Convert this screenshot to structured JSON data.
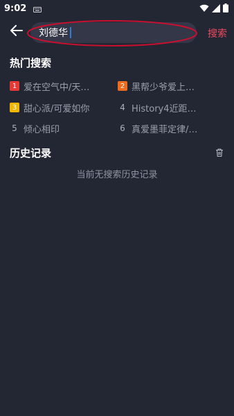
{
  "status_bar": {
    "time": "9:02"
  },
  "search": {
    "value": "刘德华",
    "action_label": "搜索"
  },
  "hot": {
    "title": "热门搜索",
    "items": [
      {
        "rank": "1",
        "text": "爱在空气中/天…",
        "color": "#e53935"
      },
      {
        "rank": "2",
        "text": "黑帮少爷爱上…",
        "color": "#ef6c1e"
      },
      {
        "rank": "3",
        "text": "甜心派/可爱如你",
        "color": "#f2b600"
      },
      {
        "rank": "4",
        "text": "History4近距…",
        "color": ""
      },
      {
        "rank": "5",
        "text": "倾心相印",
        "color": ""
      },
      {
        "rank": "6",
        "text": "真爱墨菲定律/…",
        "color": ""
      }
    ]
  },
  "history": {
    "title": "历史记录",
    "empty_text": "当前无搜索历史记录"
  },
  "colors": {
    "background": "#232633",
    "accent": "#f04a5e",
    "annotation": "#c8102e"
  },
  "icons": {
    "back": "arrow-left-icon",
    "trash": "trash-icon",
    "wifi": "wifi-icon",
    "signal": "signal-icon",
    "battery": "battery-icon",
    "keyboard": "keyboard-icon"
  }
}
